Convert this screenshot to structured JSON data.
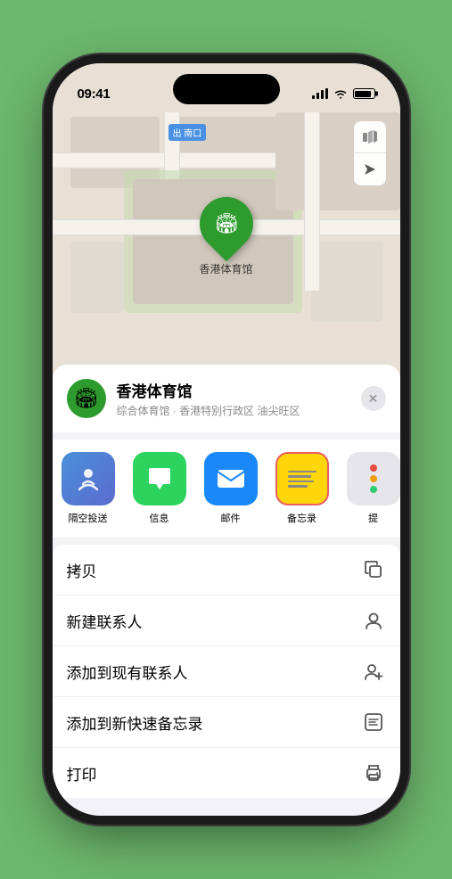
{
  "status_bar": {
    "time": "09:41",
    "location_arrow": "▶"
  },
  "map": {
    "label_text": "南口",
    "label_prefix": "出",
    "pin_label": "香港体育馆",
    "controls": {
      "map_icon": "🗺",
      "location_icon": "➤"
    }
  },
  "location_card": {
    "name": "香港体育馆",
    "subtitle": "综合体育馆 · 香港特别行政区 油尖旺区",
    "icon": "🏟"
  },
  "share_items": [
    {
      "id": "airdrop",
      "label": "隔空投送",
      "icon_type": "airdrop"
    },
    {
      "id": "message",
      "label": "信息",
      "icon_type": "message"
    },
    {
      "id": "mail",
      "label": "邮件",
      "icon_type": "mail"
    },
    {
      "id": "notes",
      "label": "备忘录",
      "icon_type": "notes"
    },
    {
      "id": "more",
      "label": "提",
      "icon_type": "more"
    }
  ],
  "actions": [
    {
      "id": "copy",
      "label": "拷贝",
      "icon": "copy"
    },
    {
      "id": "new-contact",
      "label": "新建联系人",
      "icon": "person"
    },
    {
      "id": "add-existing",
      "label": "添加到现有联系人",
      "icon": "person-add"
    },
    {
      "id": "quick-notes",
      "label": "添加到新快速备忘录",
      "icon": "notes"
    },
    {
      "id": "print",
      "label": "打印",
      "icon": "printer"
    }
  ],
  "colors": {
    "map_bg": "#e8e0d5",
    "green_pin": "#2d9b2d",
    "airdrop_bg": "#4a90d9",
    "message_bg": "#2cd45e",
    "mail_bg": "#1a88f8",
    "notes_bg": "#ffd60a",
    "notes_border": "#e85d5d"
  }
}
